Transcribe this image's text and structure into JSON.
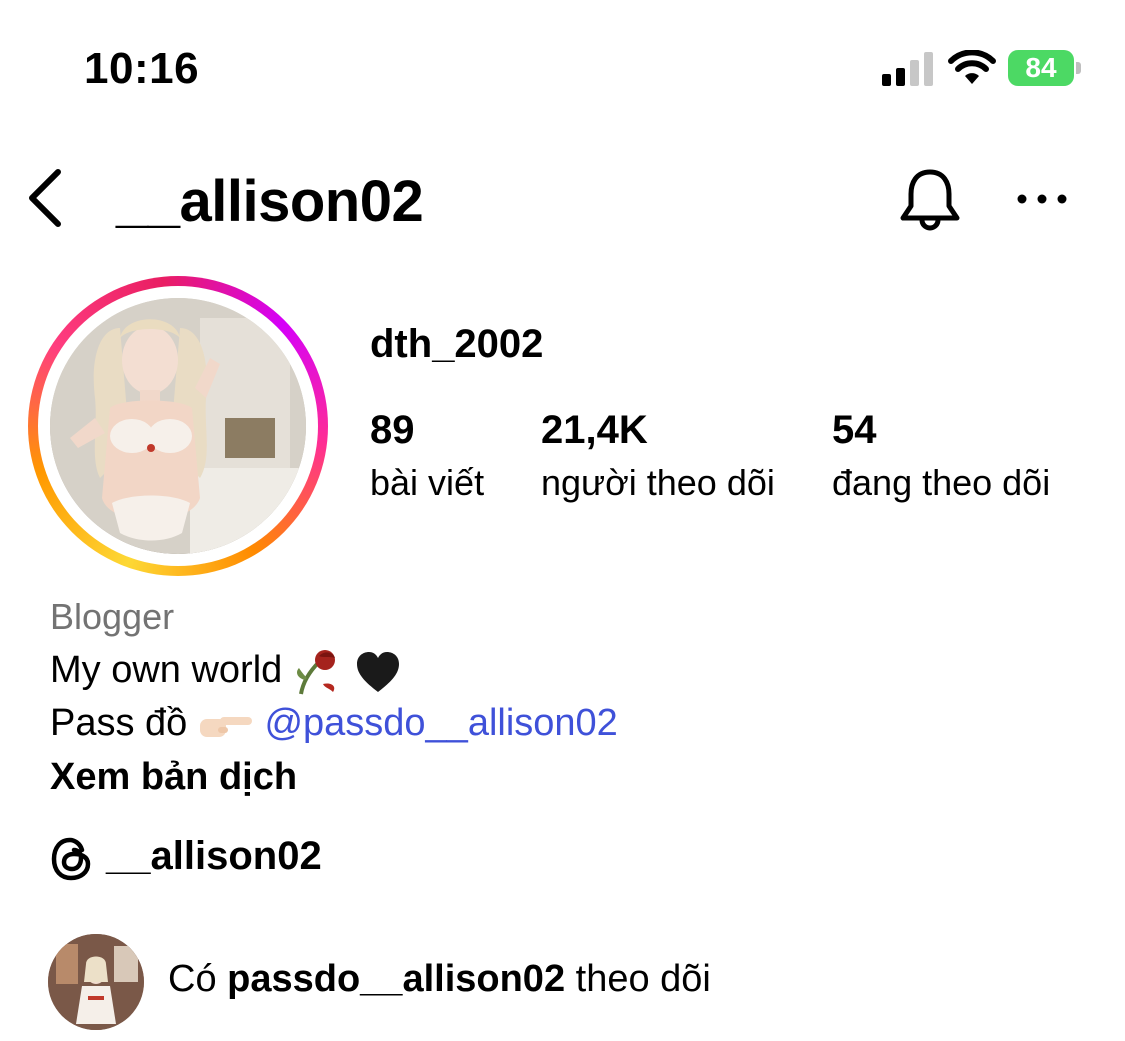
{
  "status_bar": {
    "time": "10:16",
    "battery": "84"
  },
  "header": {
    "handle": "__allison02",
    "back_icon": "chevron-left-icon",
    "bell_icon": "bell-icon",
    "more_icon": "more-icon"
  },
  "profile": {
    "name": "dth_2002",
    "stats": [
      {
        "value": "89",
        "label": "bài viết"
      },
      {
        "value": "21,4K",
        "label": "người theo dõi"
      },
      {
        "value": "54",
        "label": "đang theo dõi"
      }
    ]
  },
  "bio": {
    "category": "Blogger",
    "line1": "My own world",
    "line2_prefix": "Pass đồ",
    "mention": "@passdo__allison02",
    "translate": "Xem bản dịch"
  },
  "threads": {
    "handle": "__allison02"
  },
  "followed_by": {
    "prefix": "Có",
    "account": "passdo__allison02",
    "suffix": "theo dõi"
  },
  "colors": {
    "accent_link": "#3f51d9",
    "muted": "#737373",
    "battery_green": "#4cd964"
  }
}
